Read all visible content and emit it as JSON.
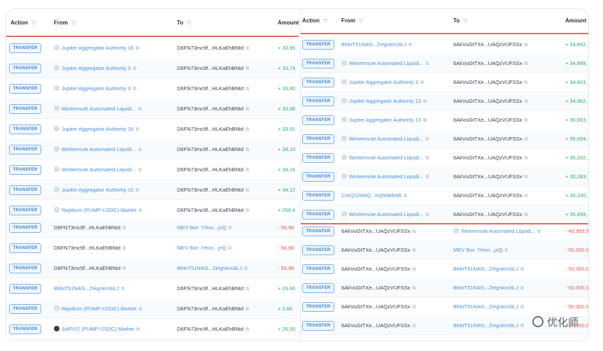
{
  "left": {
    "headers": {
      "action": "Action",
      "from": "From",
      "to": "To",
      "amount": "Amount"
    },
    "top_rows": [
      {
        "action": "TRANSFER",
        "from": "Jupiter Aggregator Authority 16",
        "to": "D6FN73mc9f...HLKaEhBNtd",
        "amount": "+ 33,95"
      },
      {
        "action": "TRANSFER",
        "from": "Jupiter Aggregator Authority 3",
        "to": "D6FN73mc9f...HLKaEhBNtd",
        "amount": "+ 33,74"
      },
      {
        "action": "TRANSFER",
        "from": "Jupiter Aggregator Authority 3",
        "to": "D6FN73mc9f...HLKaEhBNtd",
        "amount": "+ 33,80"
      },
      {
        "action": "TRANSFER",
        "from": "Wintermute Automated Liquidi...",
        "to": "D6FN73mc9f...HLKaEhBNtd",
        "amount": "+ 33,96"
      },
      {
        "action": "TRANSFER",
        "from": "Jupiter Aggregator Authority 16",
        "to": "D6FN73mc9f...HLKaEhBNtd",
        "amount": "+ 33,91"
      },
      {
        "action": "TRANSFER",
        "from": "Wintermute Automated Liquidi...",
        "to": "D6FN73mc9f...HLKaEhBNtd",
        "amount": "+ 34,10"
      },
      {
        "action": "TRANSFER",
        "from": "Wintermute Automated Liquidi...",
        "to": "D6FN73mc9f...HLKaEhBNtd",
        "amount": "+ 34,16"
      },
      {
        "action": "TRANSFER",
        "from": "Jupiter Aggregator Authority 15",
        "to": "D6FN73mc9f...HLKaEhBNtd",
        "amount": "+ 34,12"
      },
      {
        "action": "TRANSFER",
        "from": "Raydium (PUMP-USDC) Market",
        "to": "D6FN73mc9f...HLKaEhBNtd",
        "amount": "+ 259,4"
      }
    ],
    "bottom_rows": [
      {
        "action": "TRANSFER",
        "from": "D6FN73mc9f...HLKaEhBNtd",
        "to": "MEV Bot: 7rhxn...jnQ",
        "amount": "- 56,98"
      },
      {
        "action": "TRANSFER",
        "from": "D6FN73mc9f...HLKaEhBNtd",
        "to": "MEV Bot: 7rhxn...jnQ",
        "amount": "- 56,98"
      },
      {
        "action": "TRANSFER",
        "from": "D6FN73mc9f...HLKaEhBNtd",
        "to": "BMnT51N4iS...ZHgnkm3iLJ",
        "amount": "- 56,98"
      },
      {
        "action": "TRANSFER",
        "from": "BMnT51N4iS...ZHgnkm3iLJ",
        "to": "D6FN73mc9f...HLKaEhBNtd",
        "amount": "+ 29,66"
      },
      {
        "action": "TRANSFER",
        "from": "Raydium (PUMP-USDC) Market",
        "to": "D6FN73mc9f...HLKaEhBNtd",
        "amount": "+ 2,66"
      },
      {
        "action": "TRANSFER",
        "from": "SolFiV2 (PUMP-USDC) Market",
        "to": "D6FN73mc9f...HLKaEhBNtd",
        "amount": "+ 26,93"
      }
    ]
  },
  "right": {
    "headers": {
      "action": "Action",
      "from": "From",
      "to": "To",
      "amount": "Amount"
    },
    "top_rows": [
      {
        "action": "TRANSFER",
        "from": "BMnT51N4iS...ZHgnkm3iLJ",
        "to": "6AkVuGtTXe...UAQzVUFSSx",
        "amount": "+ 34,842,"
      },
      {
        "action": "TRANSFER",
        "from": "Wintermute Automated Liquidi...",
        "to": "6AkVuGtTXe...UAQzVUFSSx",
        "amount": "+ 34,889,"
      },
      {
        "action": "TRANSFER",
        "from": "Jupiter Aggregator Authority 3",
        "to": "6AkVuGtTXe...UAQzVUFSSx",
        "amount": "+ 34,901,"
      },
      {
        "action": "TRANSFER",
        "from": "Jupiter Aggregator Authority 13",
        "to": "6AkVuGtTXe...UAQzVUFSSx",
        "amount": "+ 34,962,"
      },
      {
        "action": "TRANSFER",
        "from": "Jupiter Aggregator Authority 13",
        "to": "6AkVuGtTXe...UAQzVUFSSx",
        "amount": "+ 35,003,"
      },
      {
        "action": "TRANSFER",
        "from": "Wintermute Automated Liquidi...",
        "to": "6AkVuGtTXe...UAQzVUFSSx",
        "amount": "+ 35,004,"
      },
      {
        "action": "TRANSFER",
        "from": "Wintermute Automated Liquidi...",
        "to": "6AkVuGtTXe...UAQzVUFSSx",
        "amount": "+ 35,102,"
      },
      {
        "action": "TRANSFER",
        "from": "Wintermute Automated Liquidi...",
        "to": "6AkVuGtTXe...UAQzVUFSSx",
        "amount": "+ 35,283,"
      },
      {
        "action": "TRANSFER",
        "from": "CreQJ2t94Q...hxj5MkbNft",
        "to": "6AkVuGtTXe...UAQzVUFSSx",
        "amount": "+ 35,330,"
      },
      {
        "action": "TRANSFER",
        "from": "Wintermute Automated Liquidi...",
        "to": "6AkVuGtTXe...UAQzVUFSSx",
        "amount": "+ 35,494,"
      }
    ],
    "bottom_rows": [
      {
        "action": "TRANSFER",
        "from": "6AkVuGtTXe...UAQzVUFSSx",
        "to": "Wintermute Automated Liquidi...",
        "amount": "- 49,999,9"
      },
      {
        "action": "TRANSFER",
        "from": "6AkVuGtTXe...UAQzVUFSSx",
        "to": "MEV Bot: 7rhxn...jnQ",
        "amount": "- 50,000,0"
      },
      {
        "action": "TRANSFER",
        "from": "6AkVuGtTXe...UAQzVUFSSx",
        "to": "BMnT51N4iS...ZHgnkm3iLJ",
        "amount": "- 50,000,0"
      },
      {
        "action": "TRANSFER",
        "from": "6AkVuGtTXe...UAQzVUFSSx",
        "to": "BMnT51N4iS...ZHgnkm3iLJ",
        "amount": "- 50,000,0"
      },
      {
        "action": "TRANSFER",
        "from": "6AkVuGtTXe...UAQzVUFSSx",
        "to": "BMnT51N4iS...ZHgnkm3iLJ",
        "amount": "- 50,000,0"
      },
      {
        "action": "TRANSFER",
        "from": "6AkVuGtTXe...UAQzVUFSSx",
        "to": "BMnT51N4iS...ZHgnkm3iLJ",
        "amount": "- 50,000,0"
      }
    ]
  },
  "watermark": "优化师",
  "colors": {
    "green": "#2eaa72",
    "red": "#e35b4f",
    "link": "#4a8fdc",
    "badge": "#3d83d0",
    "divider": "#e36a5e"
  }
}
